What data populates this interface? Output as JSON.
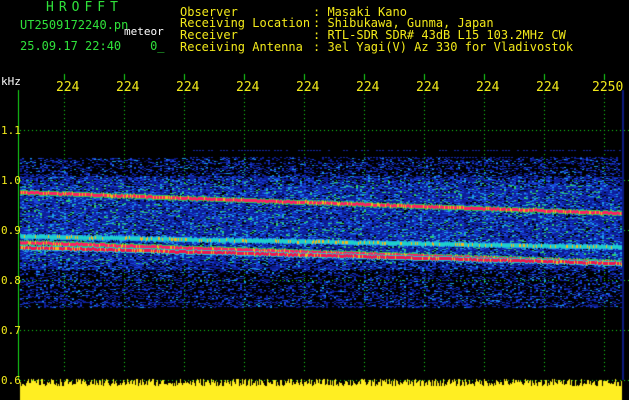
{
  "header": {
    "title": "HROFFT",
    "filename": "UT2509172240.pn",
    "tag": "meteor",
    "datetime": "25.09.17 22:40",
    "extra": "0_",
    "info": [
      {
        "label": "Observer",
        "value": ": Masaki Kano"
      },
      {
        "label": "Receiving Location",
        "value": ": Shibukawa, Gunma, Japan"
      },
      {
        "label": "Receiver",
        "value": ": RTL-SDR SDR# 43dB L15 103.2MHz CW"
      },
      {
        "label": "Receiving Antenna",
        "value": ": 3el Yagi(V) Az 330 for Vladivostok"
      }
    ]
  },
  "axes": {
    "y_unit": "kHz",
    "y_ticks": [
      "1.1",
      "1.0",
      "0.9",
      "0.8",
      "0.7",
      "0.6"
    ],
    "x_ticks": [
      "224",
      "224",
      "224",
      "224",
      "224",
      "224",
      "224",
      "224",
      "224",
      "2250"
    ]
  },
  "colors": {
    "text_green": "#2fe23a",
    "text_white": "#ffffff",
    "text_yellow": "#f2e91a",
    "grid": "#18e01a",
    "signal_red": "#ff1e64",
    "noise_blue": "#1428d2",
    "power_yellow": "#ffee22"
  }
}
